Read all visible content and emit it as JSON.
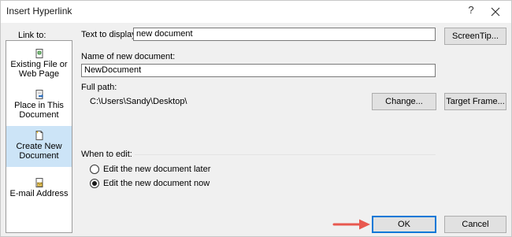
{
  "window": {
    "title": "Insert Hyperlink",
    "help_glyph": "?"
  },
  "link_to": {
    "label": "Link to:",
    "items": [
      {
        "line1": "Existing File or",
        "line2": "Web Page",
        "icon": "existing-file-icon"
      },
      {
        "line1": "Place in This",
        "line2": "Document",
        "icon": "place-in-document-icon"
      },
      {
        "line1": "Create New",
        "line2": "Document",
        "icon": "create-new-document-icon",
        "selected": true
      },
      {
        "line1": "E-mail Address",
        "line2": "",
        "icon": "email-address-icon"
      }
    ]
  },
  "text_to_display": {
    "label": "Text to display:",
    "value": "new document"
  },
  "screentip_button": "ScreenTip...",
  "name_of_new_document": {
    "label": "Name of new document:",
    "value": "NewDocument"
  },
  "full_path": {
    "label": "Full path:",
    "value": "C:\\Users\\Sandy\\Desktop\\"
  },
  "change_button": "Change...",
  "target_frame_button": "Target Frame...",
  "when_to_edit": {
    "label": "When to edit:",
    "options": [
      {
        "label": "Edit the new document later",
        "checked": false
      },
      {
        "label": "Edit the new document now",
        "checked": true
      }
    ]
  },
  "ok_button": "OK",
  "cancel_button": "Cancel",
  "colors": {
    "selected_item_bg": "#cce4f7",
    "default_button_border": "#0078d7",
    "annotation_arrow": "#e8584f"
  }
}
